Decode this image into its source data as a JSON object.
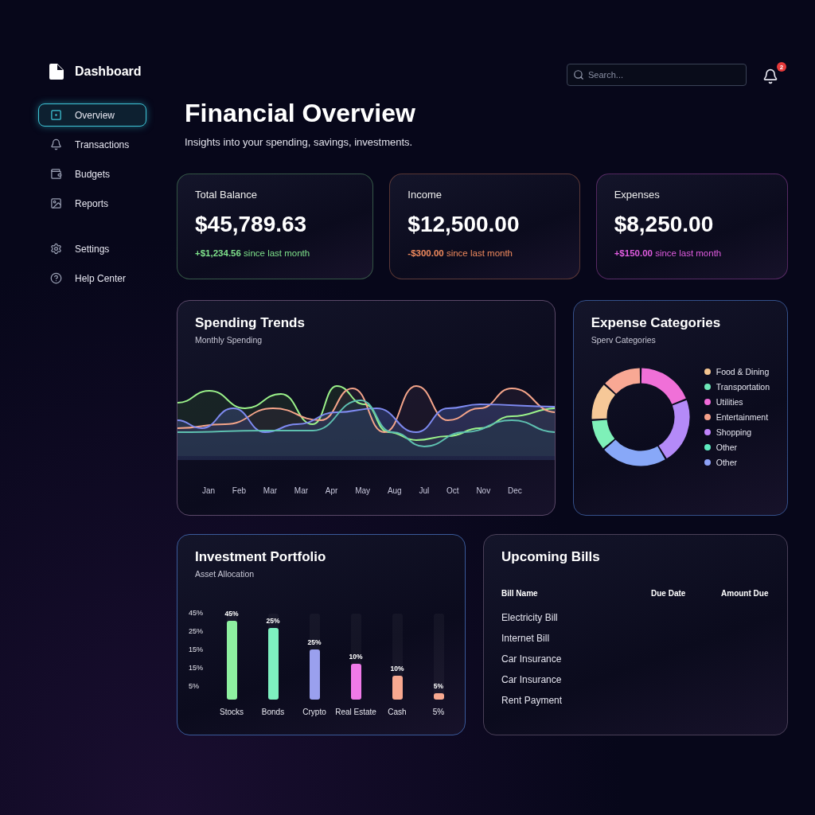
{
  "sidebar": {
    "brand": "Dashboard",
    "items": [
      {
        "label": "Overview",
        "selected": true
      },
      {
        "label": "Transactions",
        "selected": false
      },
      {
        "label": "Budgets",
        "selected": false
      },
      {
        "label": "Reports",
        "selected": false
      }
    ],
    "footer_items": [
      {
        "label": "Settings",
        "selected": false
      },
      {
        "label": "Help Center",
        "selected": false
      }
    ]
  },
  "search": {
    "placeholder": "Search..."
  },
  "notifications": {
    "count": "2"
  },
  "header": {
    "title": "Financial Overview",
    "subtitle": "Insights into your spending, savings, investments."
  },
  "stats": [
    {
      "label": "Total Balance",
      "value": "$45,789.63",
      "change": "+$1,234.56",
      "note": "since last month",
      "color": "#7ee08a"
    },
    {
      "label": "Income",
      "value": "$12,500.00",
      "change": "-$300.00",
      "note": "since last month",
      "color": "#f08a5d"
    },
    {
      "label": "Expenses",
      "value": "$8,250.00",
      "change": "+$150.00",
      "note": "since last month",
      "color": "#e05ce0"
    }
  ],
  "spending_trends": {
    "title": "Spending Trends",
    "subtitle": "Monthly Spending",
    "months": [
      "Jan",
      "Feb",
      "Mar",
      "Mar",
      "Apr",
      "May",
      "Aug",
      "Jul",
      "Oct",
      "Nov",
      "Dec"
    ]
  },
  "expense_categories": {
    "title": "Expense Categories",
    "subtitle": "Sperv Categories",
    "legend": [
      {
        "label": "Food & Dining",
        "color": "#f3c48f"
      },
      {
        "label": "Transportation",
        "color": "#6ee7b7"
      },
      {
        "label": "Utilities",
        "color": "#f06ad8"
      },
      {
        "label": "Entertainment",
        "color": "#f5a08a"
      },
      {
        "label": "Shopping",
        "color": "#c084fc"
      },
      {
        "label": "Other",
        "color": "#5eeac0"
      },
      {
        "label": "Other",
        "color": "#8ea2f8"
      }
    ]
  },
  "investment_portfolio": {
    "title": "Investment Portfolio",
    "subtitle": "Asset Allocation",
    "y_labels": [
      "45%",
      "25%",
      "15%",
      "15%",
      "5%"
    ],
    "bars": [
      {
        "label": "Stocks",
        "value_label": "45%",
        "level": 0.92
      },
      {
        "label": "Bonds",
        "value_label": "25%",
        "level": 0.83
      },
      {
        "label": "Crypto",
        "value_label": "25%",
        "level": 0.58
      },
      {
        "label": "Real Estate",
        "value_label": "10%",
        "level": 0.42
      },
      {
        "label": "Cash",
        "value_label": "10%",
        "level": 0.28
      },
      {
        "label": "5%",
        "value_label": "5%",
        "level": 0.07
      }
    ]
  },
  "upcoming_bills": {
    "title": "Upcoming Bills",
    "columns": [
      "Bill Name",
      "Due Date",
      "Amount Due"
    ],
    "rows": [
      "Electricity Bill",
      "Internet Bill",
      "Car Insurance",
      "Car Insurance",
      "Rent Payment"
    ]
  }
}
